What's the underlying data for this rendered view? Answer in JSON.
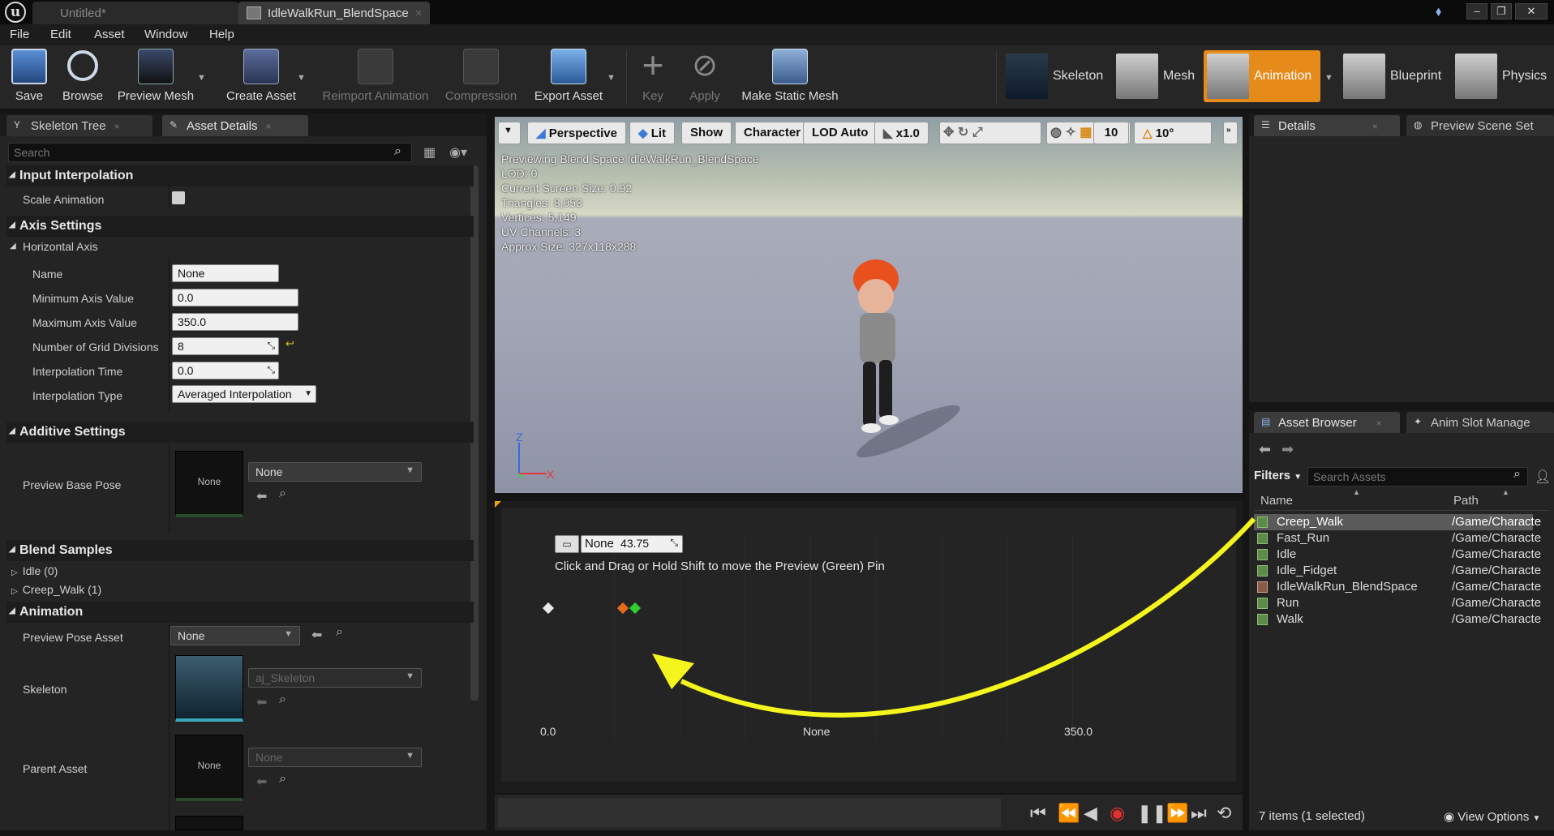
{
  "window": {
    "tabs": [
      {
        "label": "Untitled*"
      },
      {
        "label": "IdleWalkRun_BlendSpace"
      }
    ]
  },
  "menu": [
    "File",
    "Edit",
    "Asset",
    "Window",
    "Help"
  ],
  "toolbar": {
    "buttons": [
      {
        "label": "Save",
        "icon": "save-icon"
      },
      {
        "label": "Browse",
        "icon": "browse-icon"
      },
      {
        "label": "Preview Mesh",
        "icon": "preview-mesh-icon"
      },
      {
        "label": "Create Asset",
        "icon": "create-asset-icon"
      },
      {
        "label": "Reimport Animation",
        "icon": "reimport-icon"
      },
      {
        "label": "Compression",
        "icon": "compression-icon"
      },
      {
        "label": "Export Asset",
        "icon": "export-icon"
      },
      {
        "label": "Key",
        "icon": "key-plus-icon"
      },
      {
        "label": "Apply",
        "icon": "apply-check-icon"
      },
      {
        "label": "Make Static Mesh",
        "icon": "static-mesh-icon"
      }
    ],
    "modes": [
      {
        "label": "Skeleton"
      },
      {
        "label": "Mesh"
      },
      {
        "label": "Animation",
        "active": true
      },
      {
        "label": "Blueprint"
      },
      {
        "label": "Physics"
      }
    ],
    "accent": "#e68a19"
  },
  "left_panel": {
    "tabs": [
      {
        "label": "Skeleton Tree"
      },
      {
        "label": "Asset Details"
      }
    ],
    "search_placeholder": "Search",
    "sections": {
      "input_interpolation": "Input Interpolation",
      "scale_animation": "Scale Animation",
      "axis_settings": "Axis Settings",
      "horizontal_axis": "Horizontal Axis",
      "name_label": "Name",
      "name_value": "None",
      "min_label": "Minimum Axis Value",
      "min_value": "0.0",
      "max_label": "Maximum Axis Value",
      "max_value": "350.0",
      "grid_label": "Number of Grid Divisions",
      "grid_value": "8",
      "interp_time_label": "Interpolation Time",
      "interp_time_value": "0.0",
      "interp_type_label": "Interpolation Type",
      "interp_type_value": "Averaged Interpolation",
      "additive_settings": "Additive Settings",
      "preview_base_pose": "Preview Base Pose",
      "none_thumb": "None",
      "base_pose_value": "None",
      "blend_samples": "Blend Samples",
      "sample_idle": "Idle (0)",
      "sample_creep": "Creep_Walk (1)",
      "animation": "Animation",
      "preview_pose_asset": "Preview Pose Asset",
      "preview_pose_value": "None",
      "skeleton": "Skeleton",
      "skeleton_value": "aj_Skeleton",
      "parent_asset": "Parent Asset",
      "parent_value": "None"
    }
  },
  "viewport": {
    "buttons": [
      "Perspective",
      "Lit",
      "Show",
      "Character",
      "LOD Auto",
      "x1.0",
      "10",
      "10°"
    ],
    "info": [
      "Previewing Blend Space IdleWalkRun_BlendSpace",
      "LOD: 0",
      "Current Screen Size: 0.92",
      "Triangles: 8,053",
      "Vertices: 5,149",
      "UV Channels: 3",
      "Approx Size: 327x118x288"
    ],
    "axes": {
      "z": "Z",
      "x": "X"
    }
  },
  "blend_graph": {
    "pin_label": "None",
    "pin_value": "43.75",
    "hint": "Click and Drag or Hold Shift to move the Preview (Green) Pin",
    "x_min": "0.0",
    "x_label": "None",
    "x_max": "350.0",
    "samples": [
      {
        "name": "Idle",
        "x": 0
      },
      {
        "name": "Creep_Walk",
        "x": 50
      }
    ],
    "preview_pin_x": 43.75,
    "grid_divisions": 8
  },
  "right_panel": {
    "top_tabs": [
      {
        "label": "Details"
      },
      {
        "label": "Preview Scene Set"
      }
    ],
    "bottom_tabs": [
      {
        "label": "Asset Browser"
      },
      {
        "label": "Anim Slot Manage"
      }
    ],
    "filters": "Filters",
    "search_placeholder": "Search Assets",
    "columns": {
      "name": "Name",
      "path": "Path"
    },
    "assets": [
      {
        "name": "Creep_Walk",
        "path": "/Game/Characte",
        "selected": true
      },
      {
        "name": "Fast_Run",
        "path": "/Game/Characte"
      },
      {
        "name": "Idle",
        "path": "/Game/Characte"
      },
      {
        "name": "Idle_Fidget",
        "path": "/Game/Characte"
      },
      {
        "name": "IdleWalkRun_BlendSpace",
        "path": "/Game/Characte"
      },
      {
        "name": "Run",
        "path": "/Game/Characte"
      },
      {
        "name": "Walk",
        "path": "/Game/Characte"
      }
    ],
    "status": "7 items (1 selected)",
    "view_options": "View Options"
  },
  "annotation_color": "#f5f51e"
}
